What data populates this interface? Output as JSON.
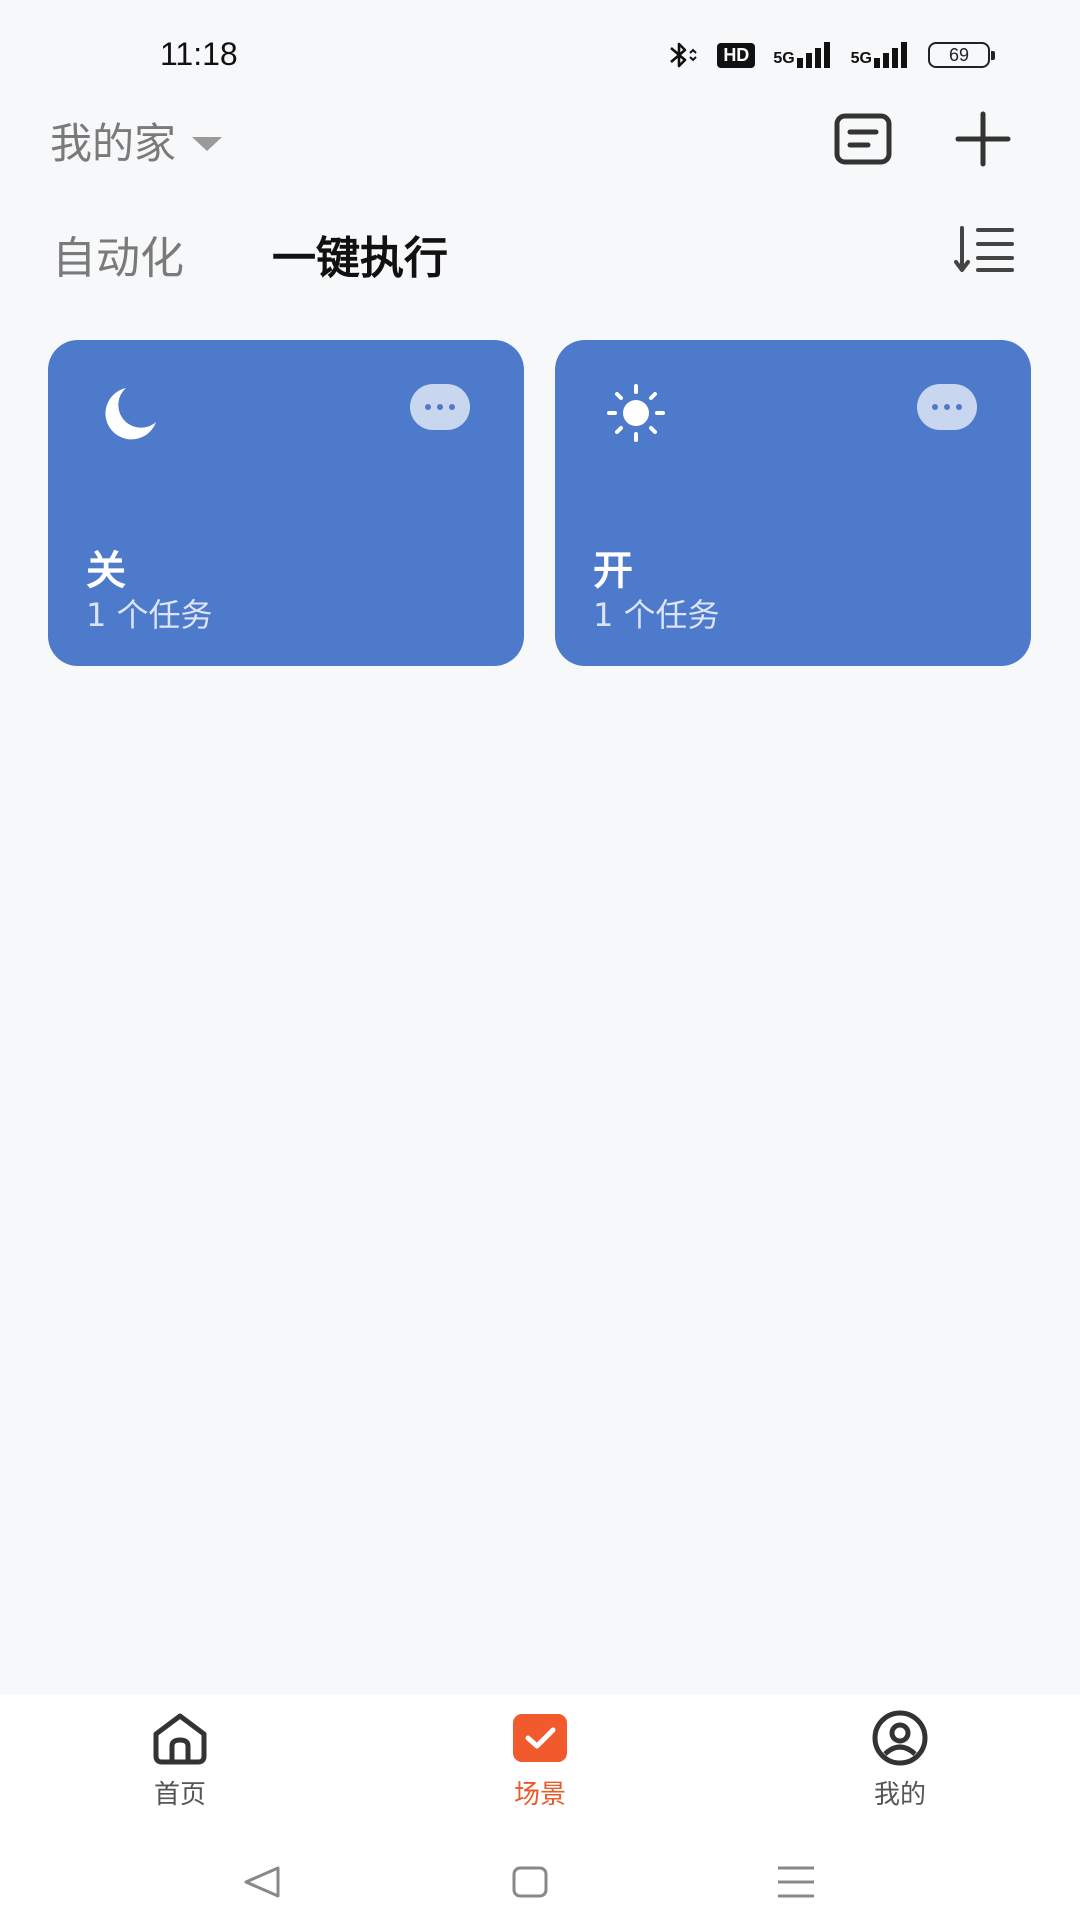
{
  "status_bar": {
    "time": "11:18",
    "hd_label": "HD",
    "signal_1_label": "5G",
    "signal_2_label": "5G",
    "battery_level": "69",
    "icons": [
      "bluetooth-icon",
      "hd-voice-icon",
      "signal-5g-icon",
      "signal-5g-icon",
      "battery-icon"
    ]
  },
  "header": {
    "home_name": "我的家",
    "icons": [
      "dropdown-caret-icon",
      "note-icon",
      "add-icon"
    ]
  },
  "tabs": {
    "automation_label": "自动化",
    "one_click_label": "一键执行",
    "active": "一键执行",
    "sort_icon": "sort-icon"
  },
  "scenes": [
    {
      "icon": "moon-icon",
      "title": "关",
      "subtitle": "1 个任务",
      "color": "#4d7acb"
    },
    {
      "icon": "sun-icon",
      "title": "开",
      "subtitle": "1 个任务",
      "color": "#4d7acb"
    }
  ],
  "bottom_nav": {
    "items": [
      {
        "label": "首页",
        "icon": "home-icon",
        "active": false
      },
      {
        "label": "场景",
        "icon": "scene-check-icon",
        "active": true
      },
      {
        "label": "我的",
        "icon": "profile-icon",
        "active": false
      }
    ],
    "accent_color": "#ea5a2a"
  },
  "system_nav": {
    "icons": [
      "back-icon",
      "home-square-icon",
      "menu-icon"
    ]
  }
}
